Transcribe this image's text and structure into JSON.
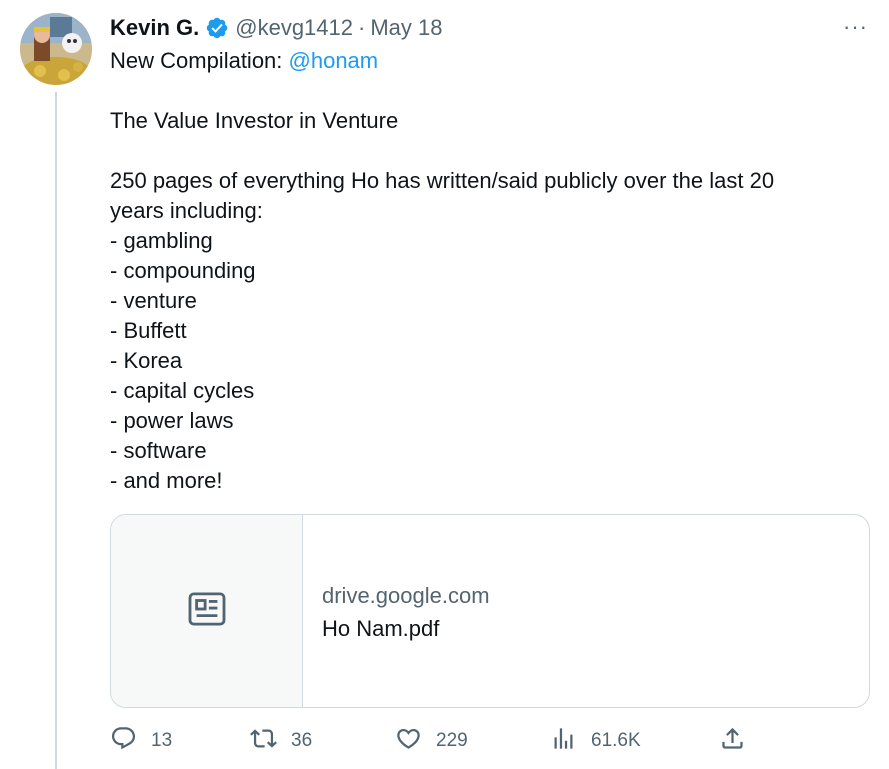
{
  "tweet": {
    "author_name": "Kevin G.",
    "handle": "@kevg1412",
    "separator": "·",
    "date": "May 18",
    "more_label": "···",
    "lines": {
      "l1_prefix": "New Compilation: ",
      "l1_mention": "@honam",
      "l2": "The Value Investor in Venture",
      "l3": "250 pages of everything Ho has written/said publicly over the last 20",
      "l4": "years including:",
      "items": [
        "- gambling",
        "- compounding",
        "- venture",
        "- Buffett",
        "- Korea",
        "- capital cycles",
        "- power laws",
        "- software",
        "- and more!"
      ]
    },
    "card": {
      "icon": "document-icon",
      "domain": "drive.google.com",
      "title": "Ho Nam.pdf"
    },
    "actions": {
      "replies": "13",
      "retweets": "36",
      "likes": "229",
      "views": "61.6K"
    }
  },
  "colors": {
    "text": "#0f1419",
    "secondary": "#536471",
    "accent": "#1d9bf0",
    "border": "#cfd9de"
  }
}
